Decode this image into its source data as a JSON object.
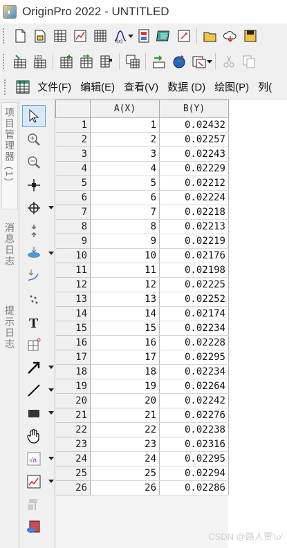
{
  "window": {
    "title": "OriginPro 2022 - UNTITLED",
    "app_icon": "origin-app-icon"
  },
  "toolbar1": {
    "icons": [
      "new-project-icon",
      "new-folder-icon",
      "new-workbook-icon",
      "new-graph-icon",
      "new-matrix-icon",
      "new-function-icon",
      "new-layout-icon",
      "new-notes-icon",
      "new-excel-icon",
      "open-icon",
      "cloud-icon",
      "save-icon"
    ]
  },
  "toolbar2": {
    "icons": [
      "import-wizard-icon",
      "import-ascii-icon",
      "add-column-icon",
      "add-sheet-icon",
      "set-column-icon",
      "duplicate-icon",
      "transfer-icon",
      "globe-icon",
      "rescale-icon",
      "cut-icon",
      "copy-icon"
    ]
  },
  "menubar": {
    "items": [
      "文件(F)",
      "编辑(E)",
      "查看(V)",
      "数据 (D)",
      "绘图(P)",
      "列("
    ]
  },
  "side_tabs": {
    "project_manager": "项目管理器 (1)",
    "message_log": "消息日志",
    "hint_log": "提示日志"
  },
  "tools": [
    "pointer-icon",
    "zoom-in-icon",
    "zoom-out-icon",
    "data-reader-icon",
    "screen-reader-icon",
    "mask-icon",
    "region-select-icon",
    "draw-data-icon",
    "scatter-points-icon",
    "text-tool-icon",
    "annotation-icon",
    "arrow-tool-icon",
    "line-tool-icon",
    "rectangle-tool-icon",
    "pan-hand-icon",
    "insert-equation-icon",
    "insert-graph-icon",
    "region-tool-icon",
    "object-icon"
  ],
  "sheet": {
    "columns": [
      "A(X)",
      "B(Y)"
    ],
    "rows": [
      [
        "1",
        "1",
        "0.02432"
      ],
      [
        "2",
        "2",
        "0.02257"
      ],
      [
        "3",
        "3",
        "0.02243"
      ],
      [
        "4",
        "4",
        "0.02229"
      ],
      [
        "5",
        "5",
        "0.02212"
      ],
      [
        "6",
        "6",
        "0.02224"
      ],
      [
        "7",
        "7",
        "0.02218"
      ],
      [
        "8",
        "8",
        "0.02213"
      ],
      [
        "9",
        "9",
        "0.02219"
      ],
      [
        "10",
        "10",
        "0.02176"
      ],
      [
        "11",
        "11",
        "0.02198"
      ],
      [
        "12",
        "12",
        "0.02225"
      ],
      [
        "13",
        "13",
        "0.02252"
      ],
      [
        "14",
        "14",
        "0.02174"
      ],
      [
        "15",
        "15",
        "0.02234"
      ],
      [
        "16",
        "16",
        "0.02228"
      ],
      [
        "17",
        "17",
        "0.02295"
      ],
      [
        "18",
        "18",
        "0.02234"
      ],
      [
        "19",
        "19",
        "0.02264"
      ],
      [
        "20",
        "20",
        "0.02242"
      ],
      [
        "21",
        "21",
        "0.02276"
      ],
      [
        "22",
        "22",
        "0.02238"
      ],
      [
        "23",
        "23",
        "0.02316"
      ],
      [
        "24",
        "24",
        "0.02295"
      ],
      [
        "25",
        "25",
        "0.02294"
      ],
      [
        "26",
        "26",
        "0.02286"
      ]
    ]
  },
  "watermark": "CSDN @路人贾'ω'"
}
